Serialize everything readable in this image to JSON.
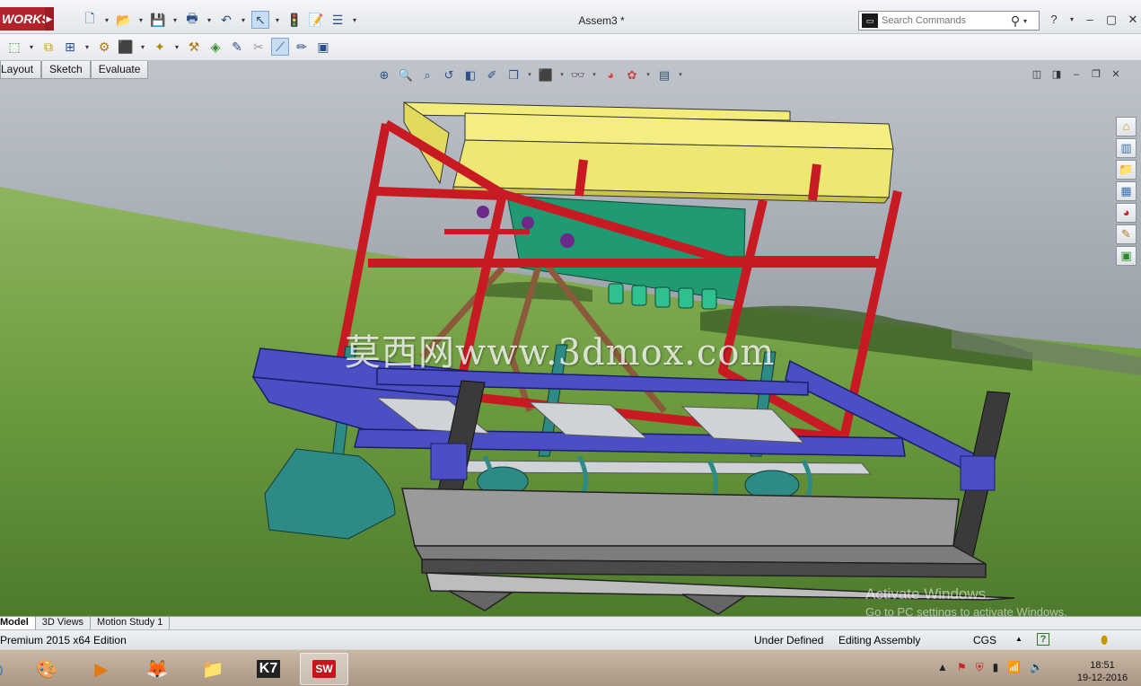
{
  "app": {
    "logo_text": "WORKS",
    "document_title": "Assem3 *"
  },
  "search": {
    "placeholder": "Search Commands"
  },
  "command_tabs": [
    "Layout",
    "Sketch",
    "Evaluate"
  ],
  "bottom_tabs": [
    "Model",
    "3D Views",
    "Motion Study 1"
  ],
  "watermark": "莫西网www.3dmox.com",
  "activation": {
    "title": "Activate Windows",
    "subtitle": "Go to PC settings to activate Windows."
  },
  "status": {
    "edition": "Premium 2015 x64 Edition",
    "definition": "Under Defined",
    "mode": "Editing Assembly",
    "units": "CGS"
  },
  "taskbar": {
    "k7_label": "K7",
    "solidworks_label": "SW"
  },
  "clock": {
    "time": "18:51",
    "date": "19-12-2016"
  },
  "colors": {
    "hopper": "#f2ec7a",
    "frame_red": "#c81a22",
    "frame_blue": "#4c4fc4",
    "metering_green": "#1f9a72",
    "furrow_teal": "#2e8a85",
    "trough_gray": "#9a9a9a"
  }
}
